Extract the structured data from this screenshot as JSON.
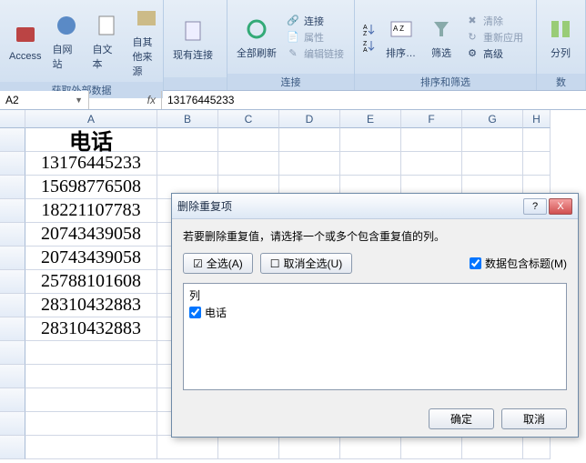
{
  "ribbon": {
    "group_data": {
      "label": "获取外部数据",
      "access": "Access",
      "web": "自网站",
      "text": "自文本",
      "other": "自其他来源",
      "existing": "现有连接"
    },
    "group_conn": {
      "label": "连接",
      "refresh": "全部刷新",
      "connections": "连接",
      "properties": "属性",
      "editlinks": "编辑链接"
    },
    "group_sort": {
      "label": "排序和筛选",
      "sort": "排序…",
      "filter": "筛选",
      "clear": "清除",
      "reapply": "重新应用",
      "advanced": "高级"
    },
    "group_tools": {
      "texttocolumns": "分列",
      "label": "数"
    }
  },
  "namebox": "A2",
  "formula": "13176445233",
  "columns": [
    "B",
    "C",
    "D",
    "E",
    "F",
    "G",
    "H"
  ],
  "col_a": "A",
  "cells": {
    "a1": "电话",
    "a2": "13176445233",
    "a3": "15698776508",
    "a4": "18221107783",
    "a5": "20743439058",
    "a6": "20743439058",
    "a7": "25788101608",
    "a8": "28310432883",
    "a9": "28310432883"
  },
  "dialog": {
    "title": "删除重复项",
    "hint": "若要删除重复值，请选择一个或多个包含重复值的列。",
    "select_all": "全选(A)",
    "unselect_all": "取消全选(U)",
    "has_header": "数据包含标题(M)",
    "col_label": "列",
    "col_item": "电话",
    "ok": "确定",
    "cancel": "取消",
    "help": "?",
    "close": "X"
  }
}
